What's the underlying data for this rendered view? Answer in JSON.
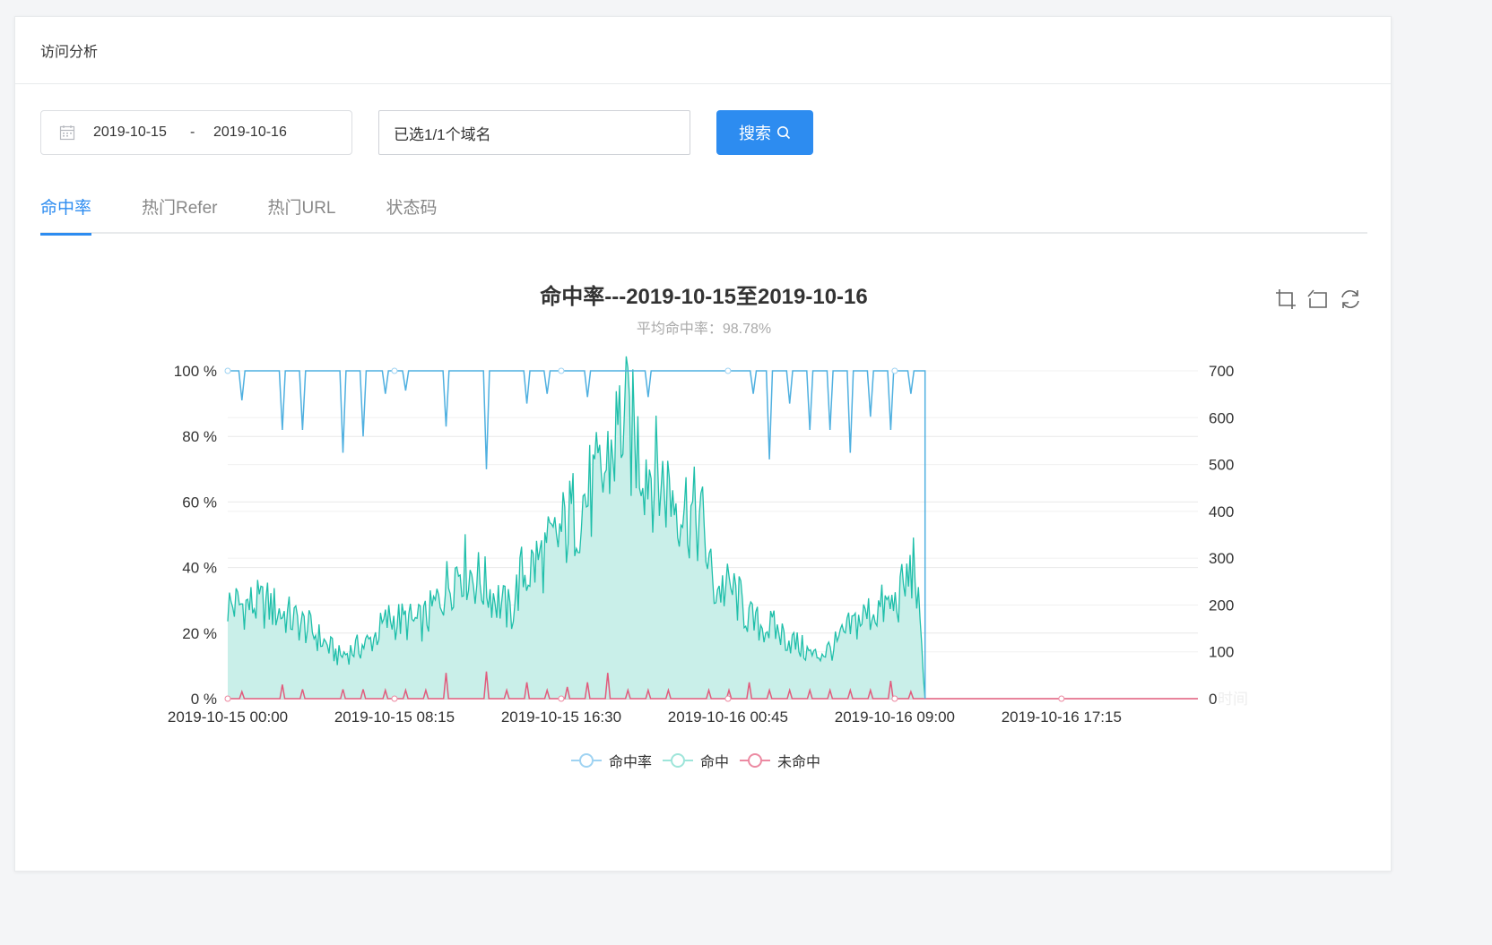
{
  "header": {
    "title": "访问分析"
  },
  "filters": {
    "date_start": "2019-10-15",
    "date_sep": "-",
    "date_end": "2019-10-16",
    "domain_value": "已选1/1个域名",
    "search_label": "搜索"
  },
  "tabs": [
    {
      "label": "命中率",
      "active": true
    },
    {
      "label": "热门Refer",
      "active": false
    },
    {
      "label": "热门URL",
      "active": false
    },
    {
      "label": "状态码",
      "active": false
    }
  ],
  "chart": {
    "title": "命中率---2019-10-15至2019-10-16",
    "subtitle": "平均命中率：98.78%",
    "tool_icons": [
      "zoom-icon",
      "zoom-reset-icon",
      "restore-icon"
    ]
  },
  "chart_data": {
    "type": "line",
    "x_tick_labels": [
      "2019-10-15 00:00",
      "2019-10-15 08:15",
      "2019-10-15 16:30",
      "2019-10-16 00:45",
      "2019-10-16 09:00",
      "2019-10-16 17:15"
    ],
    "x_axis_name": "时间",
    "y_left": {
      "ticks": [
        "0 %",
        "20 %",
        "40 %",
        "60 %",
        "80 %",
        "100 %"
      ],
      "ylim": [
        0,
        100
      ]
    },
    "y_right": {
      "ticks": [
        "0",
        "100",
        "200",
        "300",
        "400",
        "500",
        "600",
        "700"
      ],
      "ylim": [
        0,
        700
      ]
    },
    "x_range_hours": [
      0,
      48
    ],
    "data_end_hour": 34.5,
    "series": [
      {
        "name": "命中率",
        "axis": "left",
        "color": "#4fb0e0",
        "baseline": 100,
        "dips": [
          [
            0.7,
            91
          ],
          [
            2.7,
            82
          ],
          [
            3.7,
            82
          ],
          [
            5.7,
            75
          ],
          [
            6.7,
            80
          ],
          [
            7.8,
            93
          ],
          [
            8.8,
            94
          ],
          [
            10.8,
            83
          ],
          [
            12.8,
            70
          ],
          [
            14.8,
            90
          ],
          [
            15.8,
            93
          ],
          [
            17.8,
            92
          ],
          [
            20.8,
            92
          ],
          [
            26.0,
            93
          ],
          [
            26.8,
            73
          ],
          [
            27.8,
            90
          ],
          [
            28.8,
            82
          ],
          [
            29.8,
            82
          ],
          [
            30.8,
            75
          ],
          [
            31.8,
            86
          ],
          [
            32.8,
            82
          ],
          [
            33.8,
            93
          ]
        ]
      },
      {
        "name": "命中",
        "axis": "right",
        "color": "#1fbfaa",
        "fill": "#c9efe9",
        "anchors": [
          [
            0,
            200
          ],
          [
            2,
            200
          ],
          [
            4,
            150
          ],
          [
            5.5,
            90
          ],
          [
            7,
            120
          ],
          [
            8,
            170
          ],
          [
            9.5,
            160
          ],
          [
            10,
            180
          ],
          [
            11.5,
            290
          ],
          [
            13,
            230
          ],
          [
            14,
            180
          ],
          [
            14.5,
            260
          ],
          [
            16,
            320
          ],
          [
            17.5,
            420
          ],
          [
            18.5,
            460
          ],
          [
            19.5,
            600
          ],
          [
            20.5,
            520
          ],
          [
            21.5,
            460
          ],
          [
            22,
            440
          ],
          [
            23.5,
            370
          ],
          [
            24,
            240
          ],
          [
            25,
            230
          ],
          [
            26,
            160
          ],
          [
            27,
            150
          ],
          [
            28,
            120
          ],
          [
            29,
            90
          ],
          [
            30,
            110
          ],
          [
            31,
            160
          ],
          [
            32,
            190
          ],
          [
            33,
            200
          ],
          [
            33.5,
            240
          ],
          [
            34,
            290
          ],
          [
            34.5,
            0
          ]
        ]
      },
      {
        "name": "未命中",
        "axis": "right",
        "color": "#e15b7c",
        "spikes": [
          [
            0.7,
            15
          ],
          [
            2.7,
            30
          ],
          [
            3.7,
            20
          ],
          [
            5.7,
            20
          ],
          [
            6.7,
            20
          ],
          [
            7.8,
            18
          ],
          [
            8.8,
            18
          ],
          [
            9.8,
            18
          ],
          [
            10.8,
            55
          ],
          [
            12.8,
            58
          ],
          [
            13.8,
            18
          ],
          [
            14.8,
            35
          ],
          [
            15.8,
            18
          ],
          [
            16.8,
            25
          ],
          [
            17.8,
            35
          ],
          [
            18.8,
            55
          ],
          [
            19.8,
            18
          ],
          [
            20.8,
            18
          ],
          [
            21.8,
            18
          ],
          [
            23.8,
            18
          ],
          [
            24.8,
            18
          ],
          [
            25.8,
            35
          ],
          [
            26.8,
            18
          ],
          [
            27.8,
            18
          ],
          [
            28.8,
            18
          ],
          [
            29.8,
            18
          ],
          [
            30.8,
            18
          ],
          [
            31.8,
            18
          ],
          [
            32.8,
            38
          ],
          [
            33.8,
            15
          ]
        ]
      }
    ],
    "legend_position": "bottom-center",
    "grid": true
  }
}
